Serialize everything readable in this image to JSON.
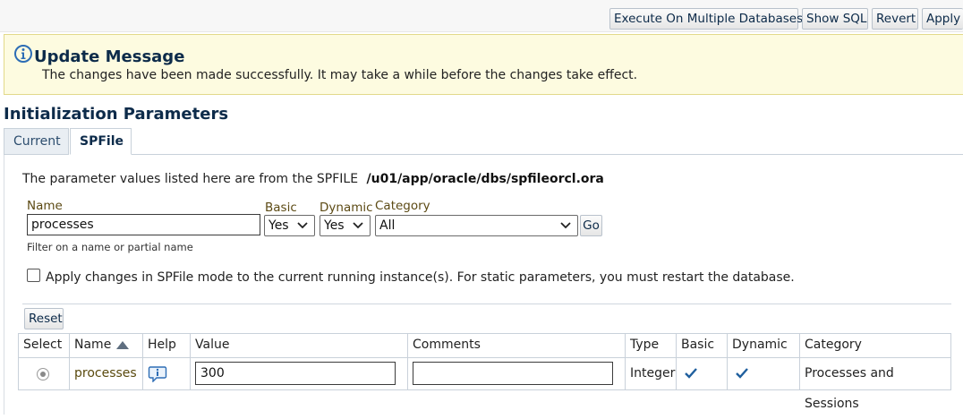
{
  "toolbar": {
    "execute_label": "Execute On Multiple Databases",
    "showsql_label": "Show SQL",
    "revert_label": "Revert",
    "apply_label": "Apply"
  },
  "message": {
    "title": "Update Message",
    "text": "The changes have been made successfully. It may take a while before the changes take effect.",
    "icon": "info-icon"
  },
  "section": {
    "title": "Initialization Parameters"
  },
  "tabs": [
    {
      "label": "Current",
      "selected": false
    },
    {
      "label": "SPFile",
      "selected": true
    }
  ],
  "info": {
    "prefix": "The parameter values listed here are from the SPFILE",
    "path": "/u01/app/oracle/dbs/spfileorcl.ora"
  },
  "filters": {
    "name_label": "Name",
    "name_value": "processes",
    "basic_label": "Basic",
    "basic_value": "Yes",
    "dynamic_label": "Dynamic",
    "dynamic_value": "Yes",
    "category_label": "Category",
    "category_value": "All",
    "go_label": "Go",
    "hint": "Filter on a name or partial name"
  },
  "apply_spfile": {
    "checked": false,
    "label": "Apply changes in SPFile mode to the current running instance(s). For static parameters, you must restart the database."
  },
  "table": {
    "reset_label": "Reset",
    "columns": [
      "Select",
      "Name",
      "Help",
      "Value",
      "Comments",
      "Type",
      "Basic",
      "Dynamic",
      "Category"
    ],
    "sort_column": "Name",
    "sort_direction": "ascending",
    "rows": [
      {
        "selected": true,
        "name": "processes",
        "value": "300",
        "comments": "",
        "type": "Integer",
        "basic": true,
        "dynamic": true,
        "category": "Processes and Sessions"
      }
    ]
  },
  "colors": {
    "message_bg": "#fdfbe0",
    "heading": "#0d2b4a",
    "link": "#5a4a0e",
    "check": "#1f5f9e"
  }
}
